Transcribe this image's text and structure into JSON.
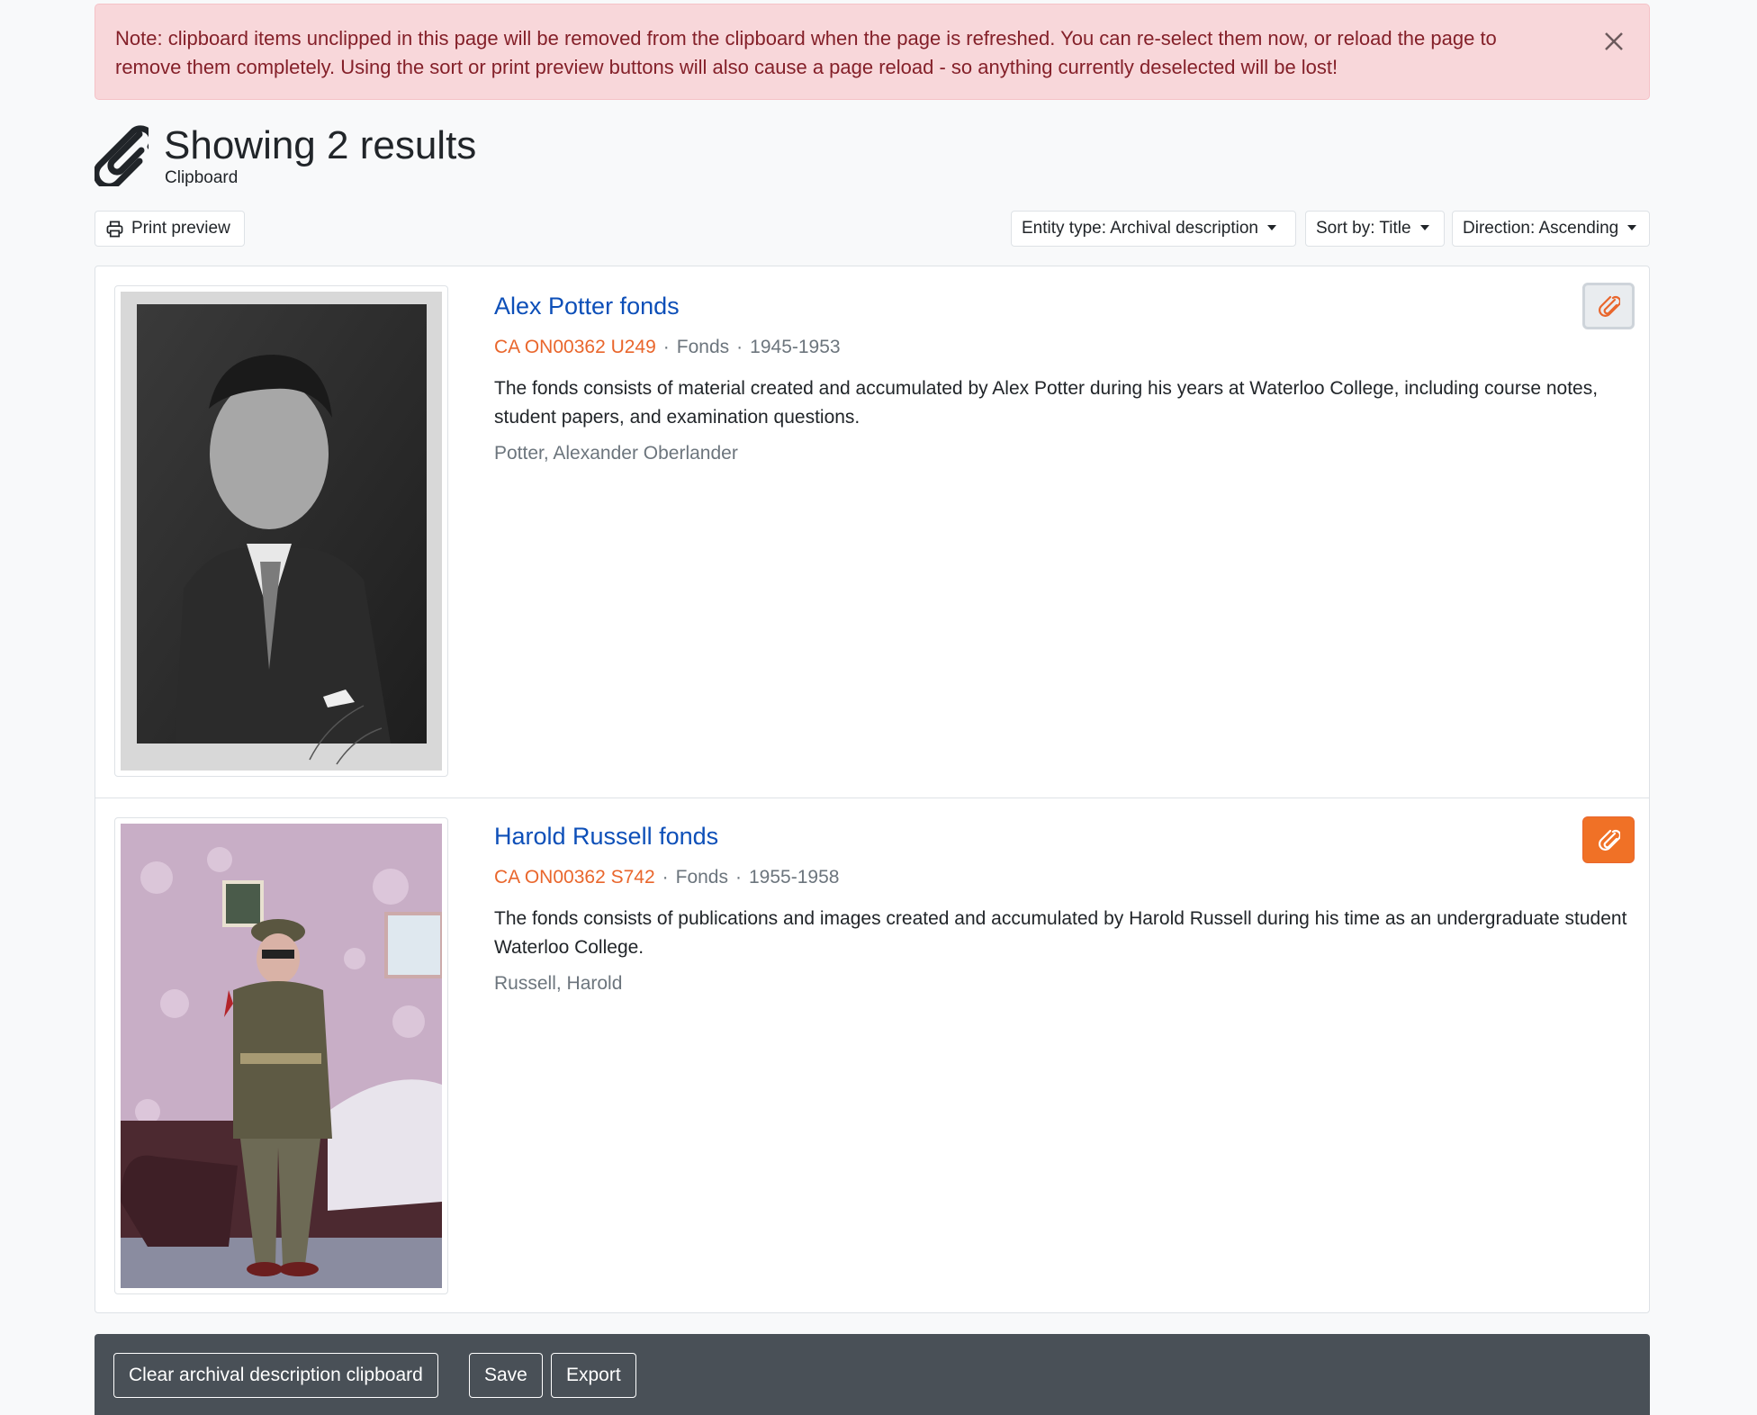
{
  "alert": {
    "message": "Note: clipboard items unclipped in this page will be removed from the clipboard when the page is refreshed. You can re-select them now, or reload the page to remove them completely. Using the sort or print preview buttons will also cause a page reload - so anything currently deselected will be lost!"
  },
  "header": {
    "title": "Showing 2 results",
    "subtitle": "Clipboard"
  },
  "toolbar": {
    "print_label": "Print preview",
    "entity_type_label": "Entity type: Archival description",
    "sort_label": "Sort by: Title",
    "direction_label": "Direction: Ascending"
  },
  "results": [
    {
      "title": "Alex Potter fonds",
      "reference": "CA ON00362 U249",
      "level": "Fonds",
      "dates": "1945-1953",
      "description": "The fonds consists of material created and accumulated by Alex Potter during his years at Waterloo College, including course notes, student papers, and examination questions.",
      "creator": "Potter, Alexander Oberlander",
      "clipped": false
    },
    {
      "title": "Harold Russell fonds",
      "reference": "CA ON00362 S742",
      "level": "Fonds",
      "dates": "1955-1958",
      "description": "The fonds consists of publications and images created and accumulated by Harold Russell during his time as an undergraduate student Waterloo College.",
      "creator": "Russell, Harold",
      "clipped": true
    }
  ],
  "actions": {
    "clear_label": "Clear archival description clipboard",
    "save_label": "Save",
    "export_label": "Export"
  },
  "colors": {
    "accent": "#e9662c",
    "link": "#0d4fb8",
    "alert_bg": "#f8d7da",
    "bottom_bar": "#495057"
  },
  "icons": [
    "close-icon",
    "paperclip-icon",
    "printer-icon",
    "caret-down-icon"
  ]
}
